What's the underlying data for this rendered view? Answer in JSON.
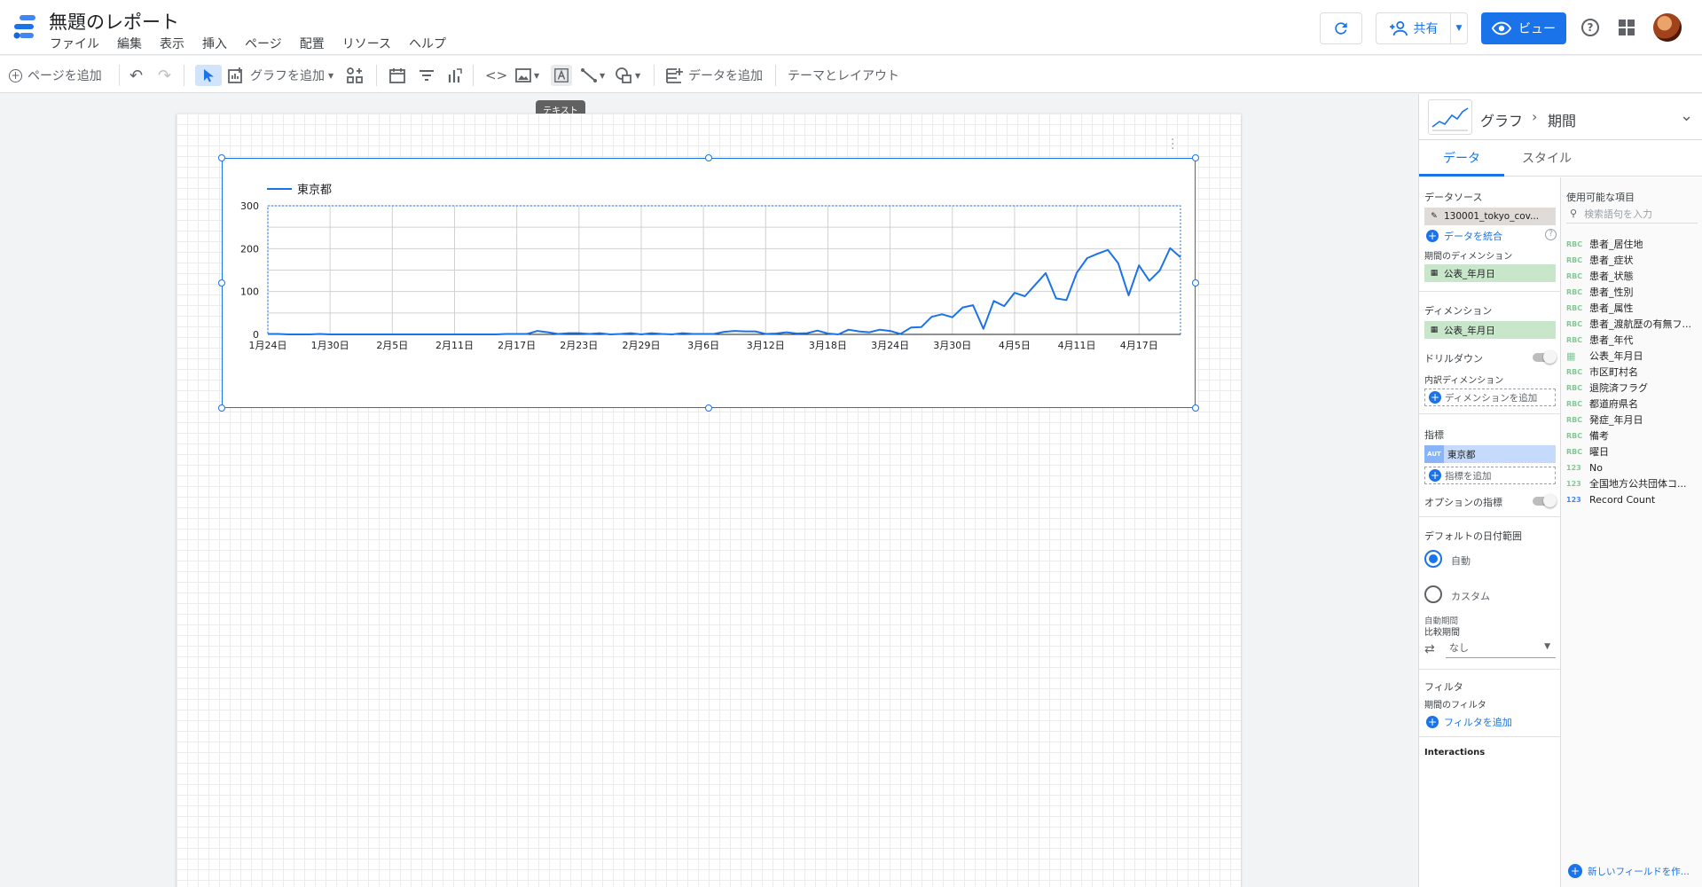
{
  "header": {
    "title": "無題のレポート",
    "menu": [
      "ファイル",
      "編集",
      "表示",
      "挿入",
      "ページ",
      "配置",
      "リソース",
      "ヘルプ"
    ],
    "share_label": "共有",
    "view_label": "ビュー",
    "help_symbol": "?"
  },
  "toolbar": {
    "add_page": "ページを追加",
    "add_chart": "グラフを追加",
    "add_data": "データを追加",
    "theme_layout": "テーマとレイアウト",
    "tooltip": "テキスト"
  },
  "chart_data": {
    "type": "line",
    "legend": "東京都",
    "x_ticks": [
      "1月24日",
      "1月30日",
      "2月5日",
      "2月11日",
      "2月17日",
      "2月23日",
      "2月29日",
      "3月6日",
      "3月12日",
      "3月18日",
      "3月24日",
      "3月30日",
      "4月5日",
      "4月11日",
      "4月17日"
    ],
    "y_ticks": [
      "300",
      "200",
      "100",
      "0"
    ],
    "ylim": [
      0,
      300
    ],
    "series": [
      {
        "name": "東京都",
        "color": "#1a73e8",
        "values": [
          1,
          1,
          0,
          0,
          0,
          1,
          0,
          0,
          0,
          0,
          0,
          0,
          0,
          0,
          0,
          0,
          0,
          0,
          0,
          0,
          0,
          0,
          0,
          1,
          1,
          1,
          8,
          5,
          1,
          3,
          3,
          1,
          3,
          0,
          1,
          3,
          0,
          3,
          1,
          0,
          3,
          1,
          1,
          1,
          6,
          8,
          7,
          7,
          1,
          2,
          5,
          2,
          3,
          9,
          2,
          0,
          11,
          7,
          5,
          11,
          8,
          1,
          16,
          17,
          41,
          47,
          40,
          63,
          68,
          13,
          78,
          66,
          97,
          89,
          116,
          143,
          84,
          80,
          144,
          178,
          188,
          197,
          166,
          91,
          161,
          125,
          149,
          201,
          180
        ]
      }
    ]
  },
  "panel": {
    "breadcrumb_graph": "グラフ",
    "breadcrumb_sep": "›",
    "breadcrumb_period": "期間",
    "tab_data": "データ",
    "tab_style": "スタイル",
    "datasource_label": "データソース",
    "datasource_name": "130001_tokyo_cov...",
    "blend_data": "データを統合",
    "period_dimension_label": "期間のディメンション",
    "period_dimension_value": "公表_年月日",
    "dimension_label": "ディメンション",
    "dimension_value": "公表_年月日",
    "drilldown_label": "ドリルダウン",
    "breakdown_label": "内訳ディメンション",
    "add_dimension": "ディメンションを追加",
    "metric_label": "指標",
    "metric_type": "AUT",
    "metric_value": "東京都",
    "add_metric": "指標を追加",
    "optional_metric_label": "オプションの指標",
    "default_range_label": "デフォルトの日付範囲",
    "radio_auto": "自動",
    "radio_custom": "カスタム",
    "auto_period_label": "自動期間",
    "compare_label": "比較期間",
    "compare_value": "なし",
    "filter_label": "フィルタ",
    "period_filter_label": "期間のフィルタ",
    "add_filter": "フィルタを追加",
    "interactions_label": "Interactions",
    "available_label": "使用可能な項目",
    "search_placeholder": "検索語句を入力",
    "fields": [
      {
        "type": "RBC",
        "name": "患者_居住地"
      },
      {
        "type": "RBC",
        "name": "患者_症状"
      },
      {
        "type": "RBC",
        "name": "患者_状態"
      },
      {
        "type": "RBC",
        "name": "患者_性別"
      },
      {
        "type": "RBC",
        "name": "患者_属性"
      },
      {
        "type": "RBC",
        "name": "患者_渡航歴の有無フ..."
      },
      {
        "type": "RBC",
        "name": "患者_年代"
      },
      {
        "type": "DATE",
        "name": "公表_年月日"
      },
      {
        "type": "RBC",
        "name": "市区町村名"
      },
      {
        "type": "RBC",
        "name": "退院済フラグ"
      },
      {
        "type": "RBC",
        "name": "都道府県名"
      },
      {
        "type": "RBC",
        "name": "発症_年月日"
      },
      {
        "type": "RBC",
        "name": "備考"
      },
      {
        "type": "RBC",
        "name": "曜日"
      },
      {
        "type": "123",
        "name": "No"
      },
      {
        "type": "123",
        "name": "全国地方公共団体コ..."
      },
      {
        "type": "123",
        "name": "Record Count"
      }
    ],
    "new_field": "新しいフィールドを作..."
  }
}
